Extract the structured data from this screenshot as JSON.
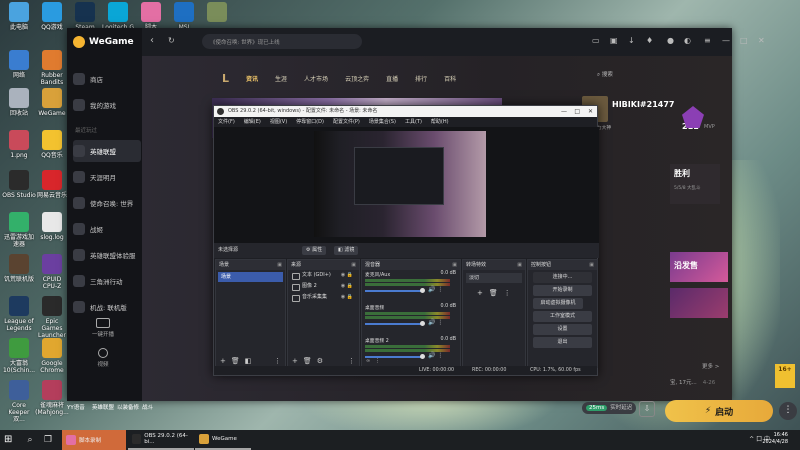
{
  "desktop_icons": [
    {
      "label": "此电脑",
      "color": "#4aa3df"
    },
    {
      "label": "QQ游戏",
      "color": "#2a9be0"
    },
    {
      "label": "Steam",
      "color": "#16324f"
    },
    {
      "label": "Logitech G HUB",
      "color": "#0aa6d6"
    },
    {
      "label": "脚本",
      "color": "#e36fa4"
    },
    {
      "label": "MSI",
      "color": "#1e6fc2"
    },
    {
      "label": "",
      "color": "#7a8d5a"
    },
    {
      "label": "网络",
      "color": "#3a7dd0"
    },
    {
      "label": "Rubber Bandits",
      "color": "#e07b2f"
    },
    {
      "label": "回收站",
      "color": "#aab2bd"
    },
    {
      "label": "WeGame",
      "color": "#d9a13a"
    },
    {
      "label": "1.png",
      "color": "#c94a5a"
    },
    {
      "label": "QQ音乐",
      "color": "#f3c22f"
    },
    {
      "label": "OBS Studio",
      "color": "#2b2b2b"
    },
    {
      "label": "网易云音乐",
      "color": "#d8262b"
    },
    {
      "label": "迅雷游戏加速器",
      "color": "#33b06a"
    },
    {
      "label": "slog.log",
      "color": "#e8e8e8"
    },
    {
      "label": "饥荒联机版",
      "color": "#5a4330"
    },
    {
      "label": "CPUID CPU-Z",
      "color": "#6b3fa0"
    },
    {
      "label": "League of Legends",
      "color": "#1d3a5f"
    },
    {
      "label": "Epic Games Launcher",
      "color": "#2a2a2a"
    },
    {
      "label": "大富翁10(Schin...",
      "color": "#3f9b3f"
    },
    {
      "label": "Google Chrome",
      "color": "#e1a72f"
    },
    {
      "label": "Core Keeper 双...",
      "color": "#3e5f9a"
    },
    {
      "label": "雀魂麻将 (Mahjong...",
      "color": "#b43e5c"
    }
  ],
  "desktop_bottom_labels": [
    "YY语音",
    "英雄联盟",
    "以装备修",
    "战斗"
  ],
  "wegame": {
    "brand": "WeGame",
    "nav": [
      "商店",
      "我的游戏"
    ],
    "recent_label": "最近玩过",
    "games": [
      "英雄联盟",
      "天涯明月",
      "使命召唤: 世界",
      "战姬",
      "英雄联盟体验服",
      "三角洲行动",
      "机战: 联机版"
    ],
    "active_game_index": 0,
    "bottom_labels": [
      "一键开播",
      "视频"
    ],
    "search_placeholder": "《使命召唤: 世界》现已上线",
    "lol_logo": "L",
    "lol_menu": [
      "资讯",
      "生涯",
      "人才市场",
      "云顶之弈",
      "直播",
      "排行",
      "百科"
    ],
    "lol_menu_active_index": 0,
    "lol_search": "搜索",
    "player_name": "HIBIKI#21477",
    "player_sub": "战力大神",
    "level": "211",
    "mvp": "MVP",
    "result": "胜利",
    "result_sub": "5/5/8 大乱斗",
    "promo_text": "沿发售",
    "more": "更多 >",
    "news": "宝, 17元...",
    "news_date": "4-26",
    "age_rating": "16+",
    "tip_tag": "25ms",
    "tip_text": "实时延迟",
    "start_label": "启动",
    "more_btn": "⋮"
  },
  "obs": {
    "title": "OBS 29.0.2 (64-bit, windows) - 配置文件: 未命名 - 场景: 未命名",
    "menu": [
      "文件(F)",
      "编辑(E)",
      "视图(V)",
      "停靠窗口(D)",
      "配置文件(P)",
      "场景集合(S)",
      "工具(T)",
      "帮助(H)"
    ],
    "no_source": "未选择源",
    "props_btn": "属性",
    "filter_btn": "滤镜",
    "docks": {
      "scenes": "场景",
      "sources": "来源",
      "mixer": "混音器",
      "transitions": "转场特效",
      "controls": "控制按钮"
    },
    "scene_items": [
      "场景"
    ],
    "source_items": [
      "文本 (GDI+)",
      "图像 2",
      "音乐采集集"
    ],
    "mixer_items": [
      {
        "name": "麦克风/Aux",
        "db": "0.0 dB"
      },
      {
        "name": "桌面音频",
        "db": "0.0 dB"
      },
      {
        "name": "桌面音频 2",
        "db": "0.0 dB"
      }
    ],
    "transition_value": "淡切",
    "control_buttons": [
      "连接中...",
      "开始录制",
      "启动虚拟摄像机",
      "工作室模式",
      "设置",
      "退出"
    ],
    "status": {
      "live": "LIVE: 00:00:00",
      "rec": "REC: 00:00:00",
      "cpu": "CPU: 1.7%, 60.00 fps"
    }
  },
  "taskbar": {
    "apps": [
      {
        "label": "脚本录制",
        "color": "#e36fa4",
        "active": true
      },
      {
        "label": "OBS 29.0.2 (64-bi...",
        "color": "#2b2b2b",
        "active": false
      },
      {
        "label": "WeGame",
        "color": "#d9a13a",
        "active": false
      }
    ],
    "tray": "^ 口 中",
    "time": "16:46",
    "date": "2024/4/28"
  }
}
